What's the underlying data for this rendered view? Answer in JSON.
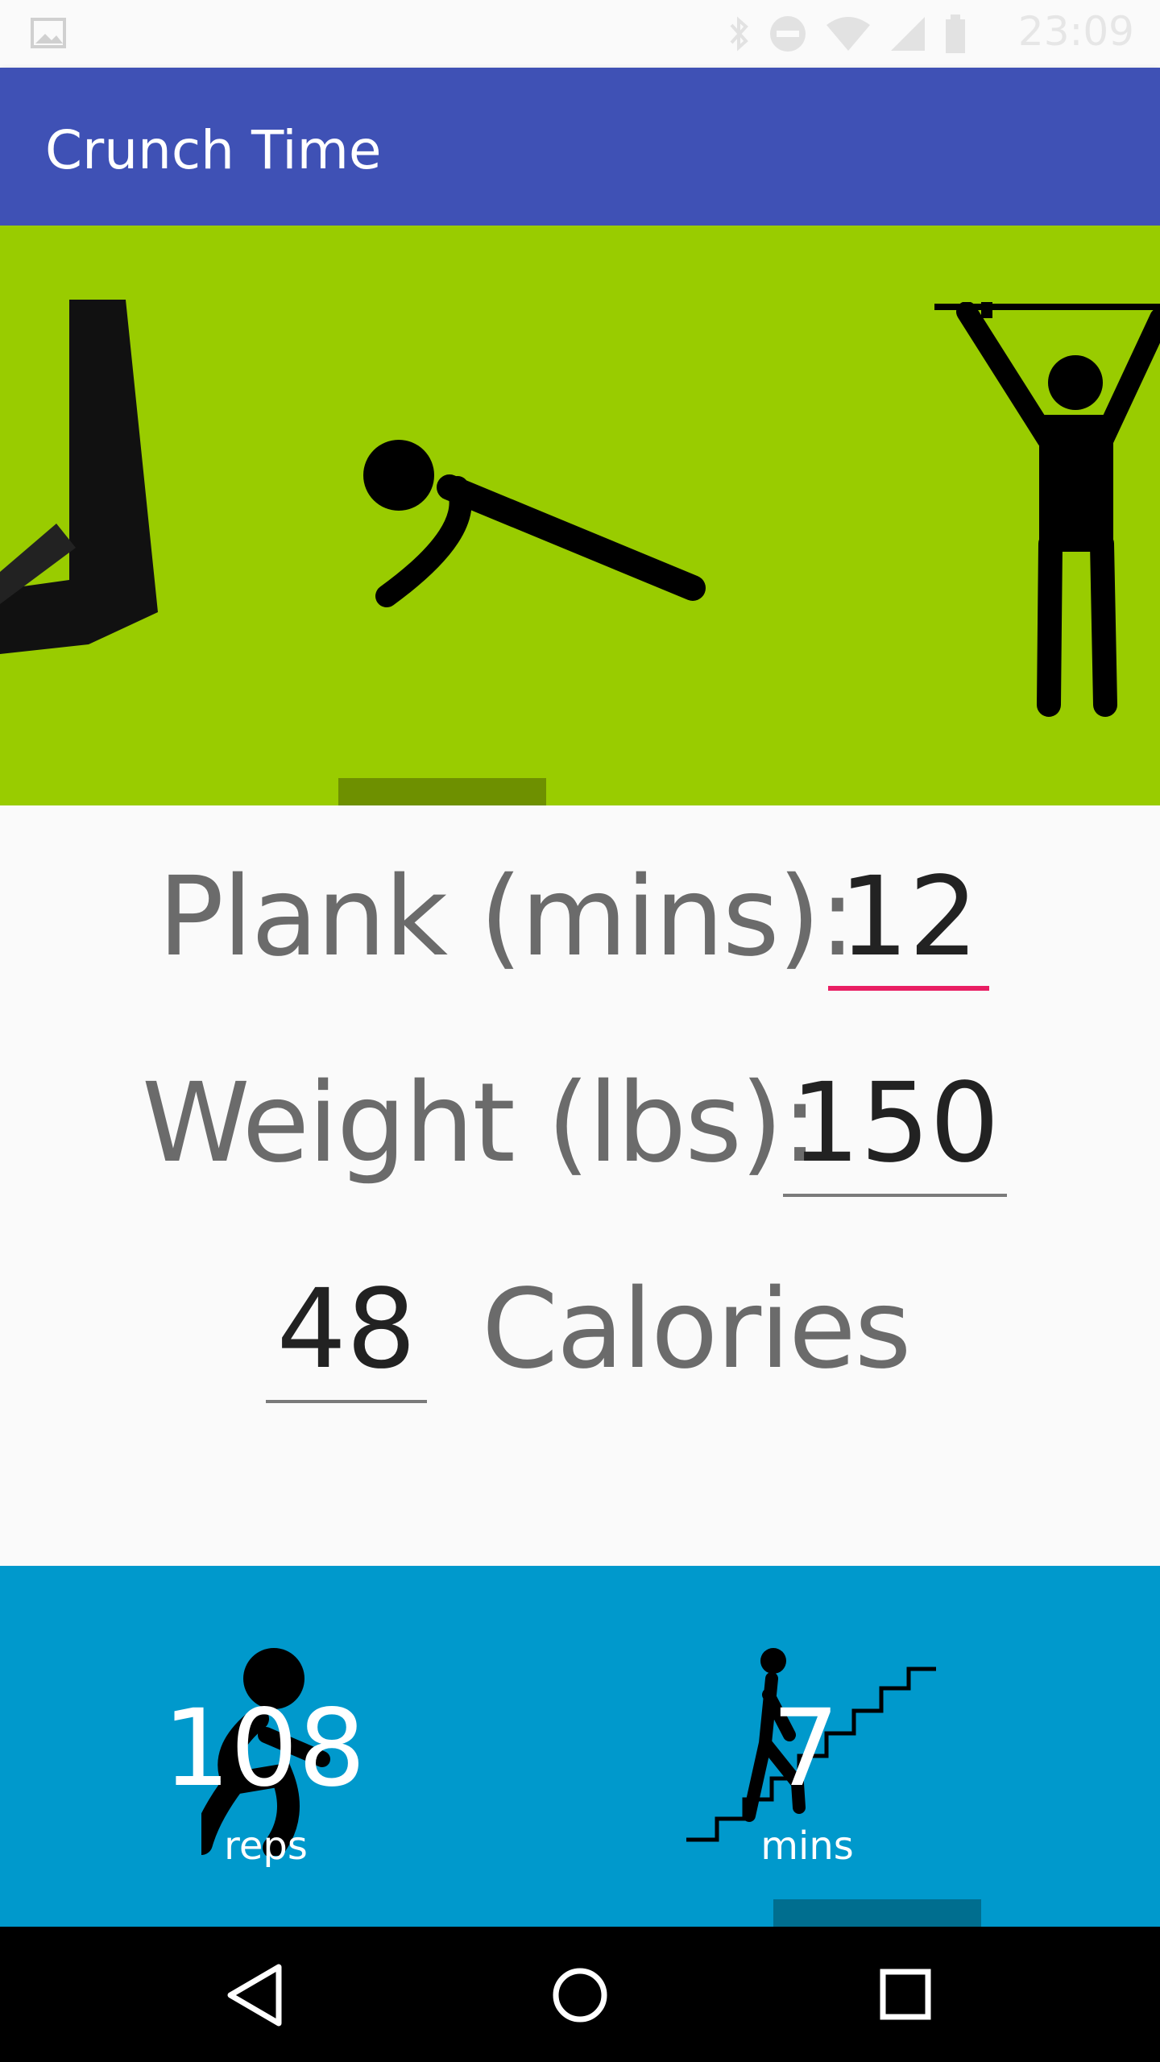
{
  "status_bar": {
    "time": "23:09",
    "icons": [
      "gallery-icon",
      "bluetooth-icon",
      "dnd-icon",
      "wifi-icon",
      "signal-icon",
      "battery-icon"
    ]
  },
  "app_bar": {
    "title": "Crunch Time"
  },
  "hero": {
    "carousel_items": [
      "leg-exercise",
      "pushup",
      "pullup"
    ]
  },
  "form": {
    "plank_label": "Plank (mins):",
    "plank_value": "12",
    "weight_label": "Weight (lbs):",
    "weight_value": "150",
    "calories_value": "48",
    "calories_label": "Calories"
  },
  "results": {
    "squats_value": "108",
    "squats_unit": "reps",
    "stairs_value": "7",
    "stairs_unit": "mins"
  },
  "colors": {
    "app_bar": "#3F51B5",
    "hero_bg": "#99CC00",
    "bottom_bg": "#0099CC",
    "accent": "#E91E63"
  },
  "nav": {
    "buttons": [
      "back-icon",
      "home-icon",
      "recents-icon"
    ]
  }
}
